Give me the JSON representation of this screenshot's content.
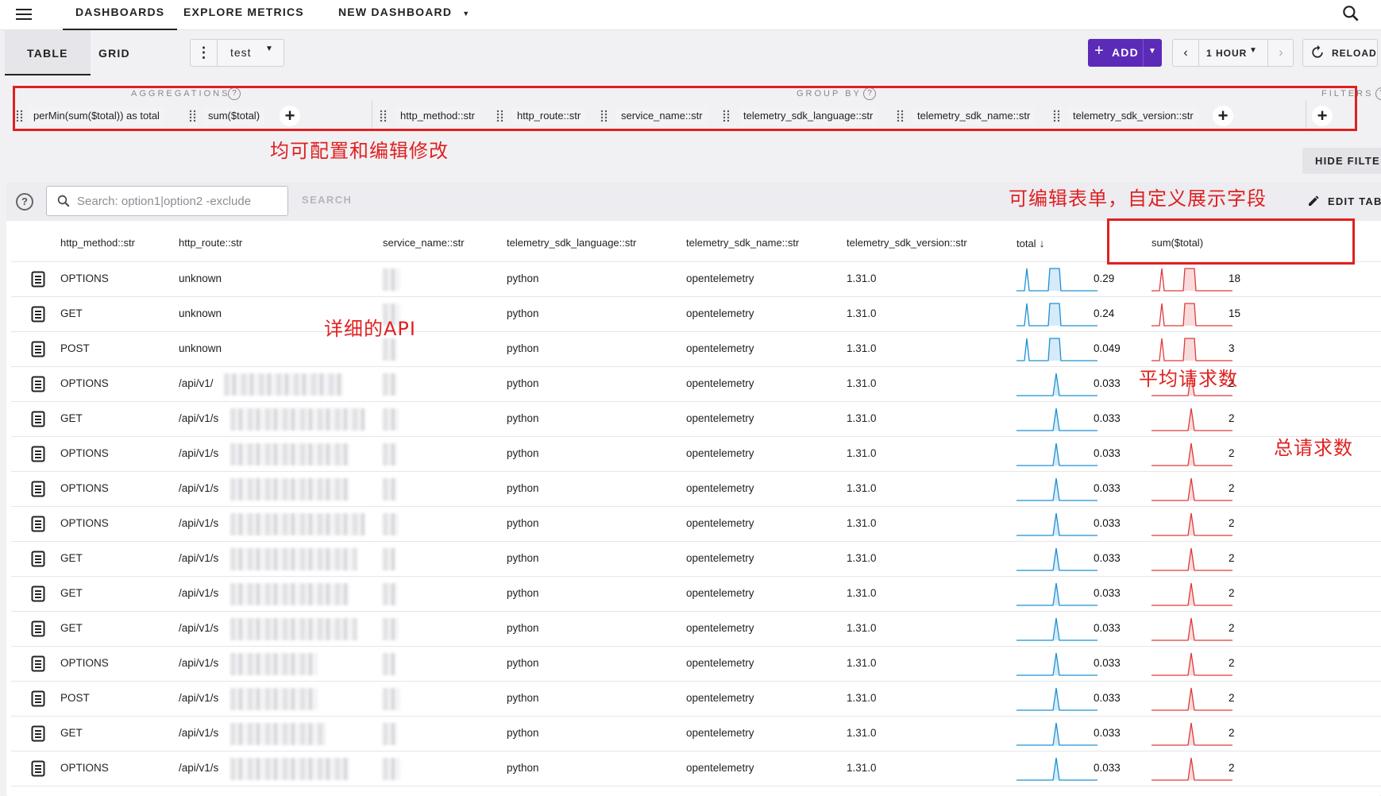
{
  "topbar": {
    "tabs": [
      "DASHBOARDS",
      "EXPLORE METRICS",
      "NEW DASHBOARD"
    ]
  },
  "toolbar": {
    "view_tabs": [
      "TABLE",
      "GRID"
    ],
    "dashboard_name": "test",
    "add_label": "ADD",
    "time_range": "1 HOUR",
    "reload_label": "RELOAD"
  },
  "config": {
    "aggregations_label": "AGGREGATIONS",
    "aggregations": [
      "perMin(sum($total)) as total",
      "sum($total)"
    ],
    "group_by_label": "GROUP BY",
    "group_by": [
      "http_method::str",
      "http_route::str",
      "service_name::str",
      "telemetry_sdk_language::str",
      "telemetry_sdk_name::str",
      "telemetry_sdk_version::str"
    ],
    "filters_label": "FILTERS",
    "hide_filters_label": "HIDE FILTE"
  },
  "table": {
    "search_placeholder": "Search: option1|option2 -exclude",
    "search_button": "SEARCH",
    "edit_label": "EDIT TAB",
    "columns": [
      "http_method::str",
      "http_route::str",
      "service_name::str",
      "telemetry_sdk_language::str",
      "telemetry_sdk_name::str",
      "telemetry_sdk_version::str",
      "total",
      "sum($total)"
    ],
    "rows": [
      {
        "method": "OPTIONS",
        "route": "unknown",
        "language": "python",
        "sdk": "opentelemetry",
        "version": "1.31.0",
        "total": "0.29",
        "sum": "18"
      },
      {
        "method": "GET",
        "route": "unknown",
        "language": "python",
        "sdk": "opentelemetry",
        "version": "1.31.0",
        "total": "0.24",
        "sum": "15"
      },
      {
        "method": "POST",
        "route": "unknown",
        "language": "python",
        "sdk": "opentelemetry",
        "version": "1.31.0",
        "total": "0.049",
        "sum": "3"
      },
      {
        "method": "OPTIONS",
        "route": "/api/v1/",
        "language": "python",
        "sdk": "opentelemetry",
        "version": "1.31.0",
        "total": "0.033",
        "sum": "2"
      },
      {
        "method": "GET",
        "route": "/api/v1/s",
        "language": "python",
        "sdk": "opentelemetry",
        "version": "1.31.0",
        "total": "0.033",
        "sum": "2"
      },
      {
        "method": "OPTIONS",
        "route": "/api/v1/s",
        "language": "python",
        "sdk": "opentelemetry",
        "version": "1.31.0",
        "total": "0.033",
        "sum": "2"
      },
      {
        "method": "OPTIONS",
        "route": "/api/v1/s",
        "language": "python",
        "sdk": "opentelemetry",
        "version": "1.31.0",
        "total": "0.033",
        "sum": "2"
      },
      {
        "method": "OPTIONS",
        "route": "/api/v1/s",
        "language": "python",
        "sdk": "opentelemetry",
        "version": "1.31.0",
        "total": "0.033",
        "sum": "2"
      },
      {
        "method": "GET",
        "route": "/api/v1/s",
        "language": "python",
        "sdk": "opentelemetry",
        "version": "1.31.0",
        "total": "0.033",
        "sum": "2"
      },
      {
        "method": "GET",
        "route": "/api/v1/s",
        "language": "python",
        "sdk": "opentelemetry",
        "version": "1.31.0",
        "total": "0.033",
        "sum": "2"
      },
      {
        "method": "GET",
        "route": "/api/v1/s",
        "language": "python",
        "sdk": "opentelemetry",
        "version": "1.31.0",
        "total": "0.033",
        "sum": "2"
      },
      {
        "method": "OPTIONS",
        "route": "/api/v1/s",
        "language": "python",
        "sdk": "opentelemetry",
        "version": "1.31.0",
        "total": "0.033",
        "sum": "2"
      },
      {
        "method": "POST",
        "route": "/api/v1/s",
        "language": "python",
        "sdk": "opentelemetry",
        "version": "1.31.0",
        "total": "0.033",
        "sum": "2"
      },
      {
        "method": "GET",
        "route": "/api/v1/s",
        "language": "python",
        "sdk": "opentelemetry",
        "version": "1.31.0",
        "total": "0.033",
        "sum": "2"
      },
      {
        "method": "OPTIONS",
        "route": "/api/v1/s",
        "language": "python",
        "sdk": "opentelemetry",
        "version": "1.31.0",
        "total": "0.033",
        "sum": "2"
      }
    ]
  },
  "annotations": {
    "config_note": "均可配置和编辑修改",
    "table_note": "可编辑表单，自定义展示字段",
    "api_note": "详细的API",
    "avg_note": "平均请求数",
    "total_note": "总请求数"
  },
  "colors": {
    "accent": "#5b2bb8",
    "spark_total": "#1e90d6",
    "spark_sum": "#e03a3a",
    "annotation": "#e02020"
  }
}
